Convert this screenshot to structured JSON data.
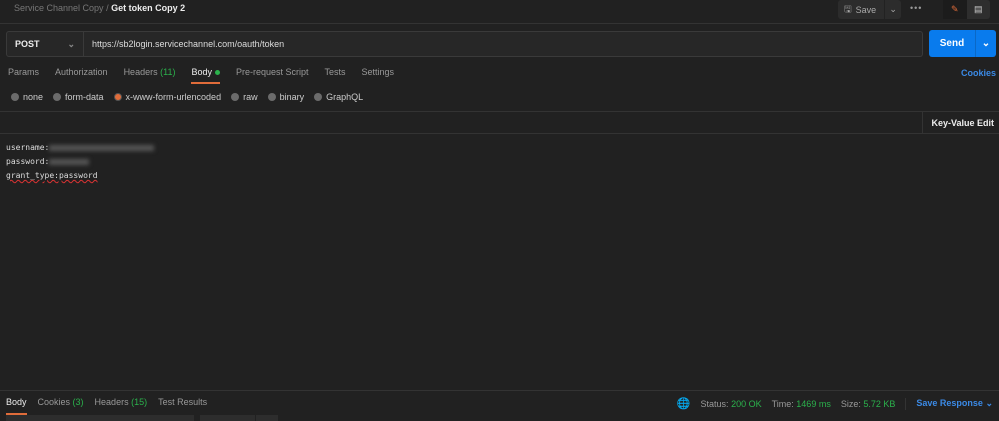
{
  "breadcrumb": {
    "collection": "Service Channel Copy",
    "separator": "/",
    "request": "Get token Copy 2"
  },
  "toolbar": {
    "save": "Save",
    "more": "•••"
  },
  "request": {
    "method": "POST",
    "url": "https://sb2login.servicechannel.com/oauth/token",
    "send": "Send"
  },
  "tabs": [
    {
      "label": "Params"
    },
    {
      "label": "Authorization"
    },
    {
      "label": "Headers",
      "count": "(11)"
    },
    {
      "label": "Body"
    },
    {
      "label": "Pre-request Script"
    },
    {
      "label": "Tests"
    },
    {
      "label": "Settings"
    }
  ],
  "cookies_link": "Cookies",
  "body_modes": [
    "none",
    "form-data",
    "x-www-form-urlencoded",
    "raw",
    "binary",
    "GraphQL"
  ],
  "key_value_edit": "Key-Value Edit",
  "editor": {
    "line1_key": "username:",
    "line2_key": "password:",
    "line3": "grant_type:password"
  },
  "response": {
    "tabs": [
      {
        "label": "Body"
      },
      {
        "label": "Cookies",
        "count": "(3)"
      },
      {
        "label": "Headers",
        "count": "(15)"
      },
      {
        "label": "Test Results"
      }
    ],
    "status_label": "Status:",
    "status": "200 OK",
    "time_label": "Time:",
    "time": "1469 ms",
    "size_label": "Size:",
    "size": "5.72 KB",
    "save_response": "Save Response"
  },
  "colors": {
    "accent": "#e06c3a",
    "primary": "#097bed",
    "success": "#2bb24c"
  }
}
